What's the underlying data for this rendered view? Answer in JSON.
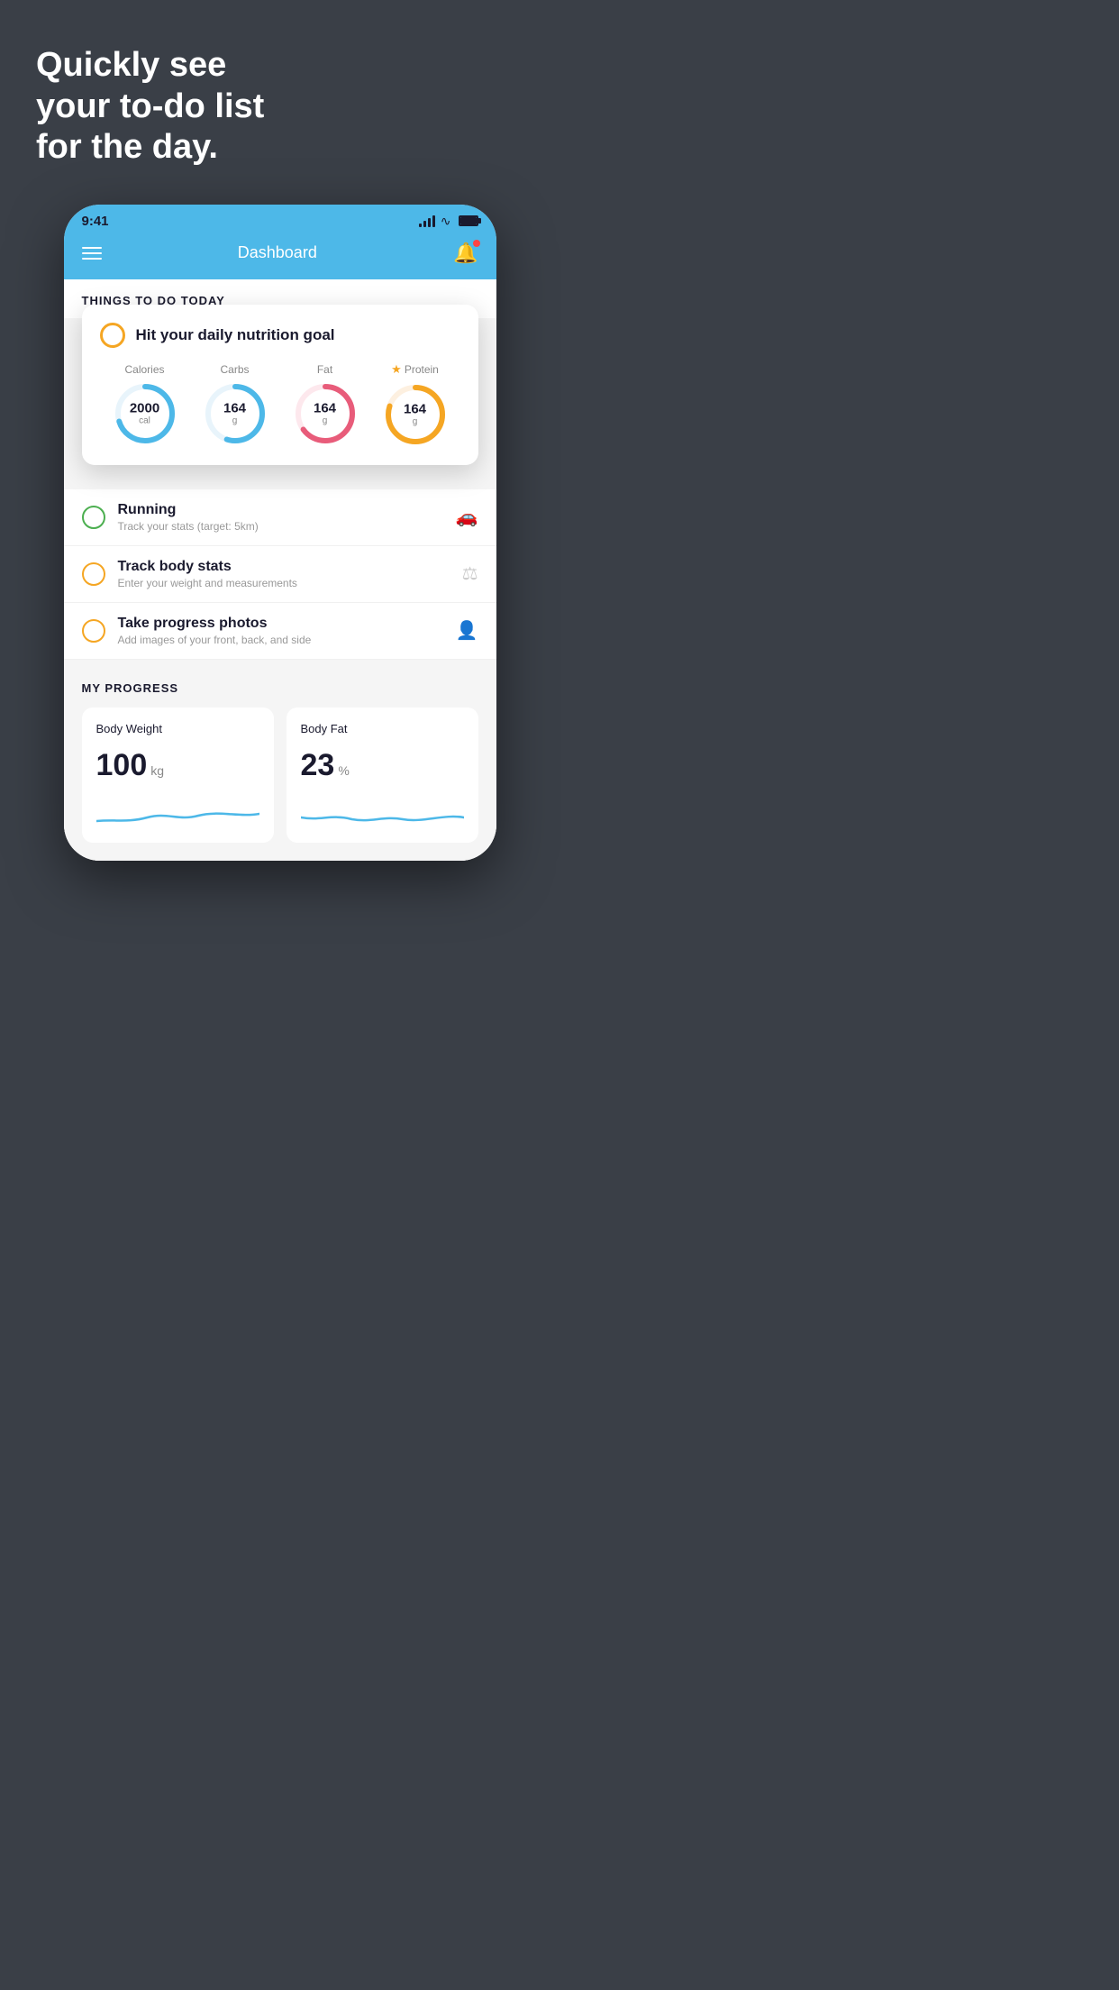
{
  "hero": {
    "title": "Quickly see\nyour to-do list\nfor the day."
  },
  "statusBar": {
    "time": "9:41"
  },
  "navBar": {
    "title": "Dashboard"
  },
  "thingsToday": {
    "heading": "THINGS TO DO TODAY"
  },
  "floatingCard": {
    "title": "Hit your daily nutrition goal",
    "nutrition": [
      {
        "label": "Calories",
        "value": "2000",
        "unit": "cal",
        "color": "#4db8e8",
        "track": 70,
        "starred": false
      },
      {
        "label": "Carbs",
        "value": "164",
        "unit": "g",
        "color": "#4db8e8",
        "track": 55,
        "starred": false
      },
      {
        "label": "Fat",
        "value": "164",
        "unit": "g",
        "color": "#e85c7a",
        "track": 65,
        "starred": false
      },
      {
        "label": "Protein",
        "value": "164",
        "unit": "g",
        "color": "#f5a623",
        "track": 80,
        "starred": true
      }
    ]
  },
  "todoItems": [
    {
      "id": "running",
      "title": "Running",
      "subtitle": "Track your stats (target: 5km)",
      "circleColor": "green",
      "icon": "🥿"
    },
    {
      "id": "body-stats",
      "title": "Track body stats",
      "subtitle": "Enter your weight and measurements",
      "circleColor": "yellow",
      "icon": "⚖"
    },
    {
      "id": "progress-photos",
      "title": "Take progress photos",
      "subtitle": "Add images of your front, back, and side",
      "circleColor": "yellow",
      "icon": "👤"
    }
  ],
  "progress": {
    "heading": "MY PROGRESS",
    "cards": [
      {
        "title": "Body Weight",
        "value": "100",
        "unit": "kg"
      },
      {
        "title": "Body Fat",
        "value": "23",
        "unit": "%"
      }
    ]
  }
}
